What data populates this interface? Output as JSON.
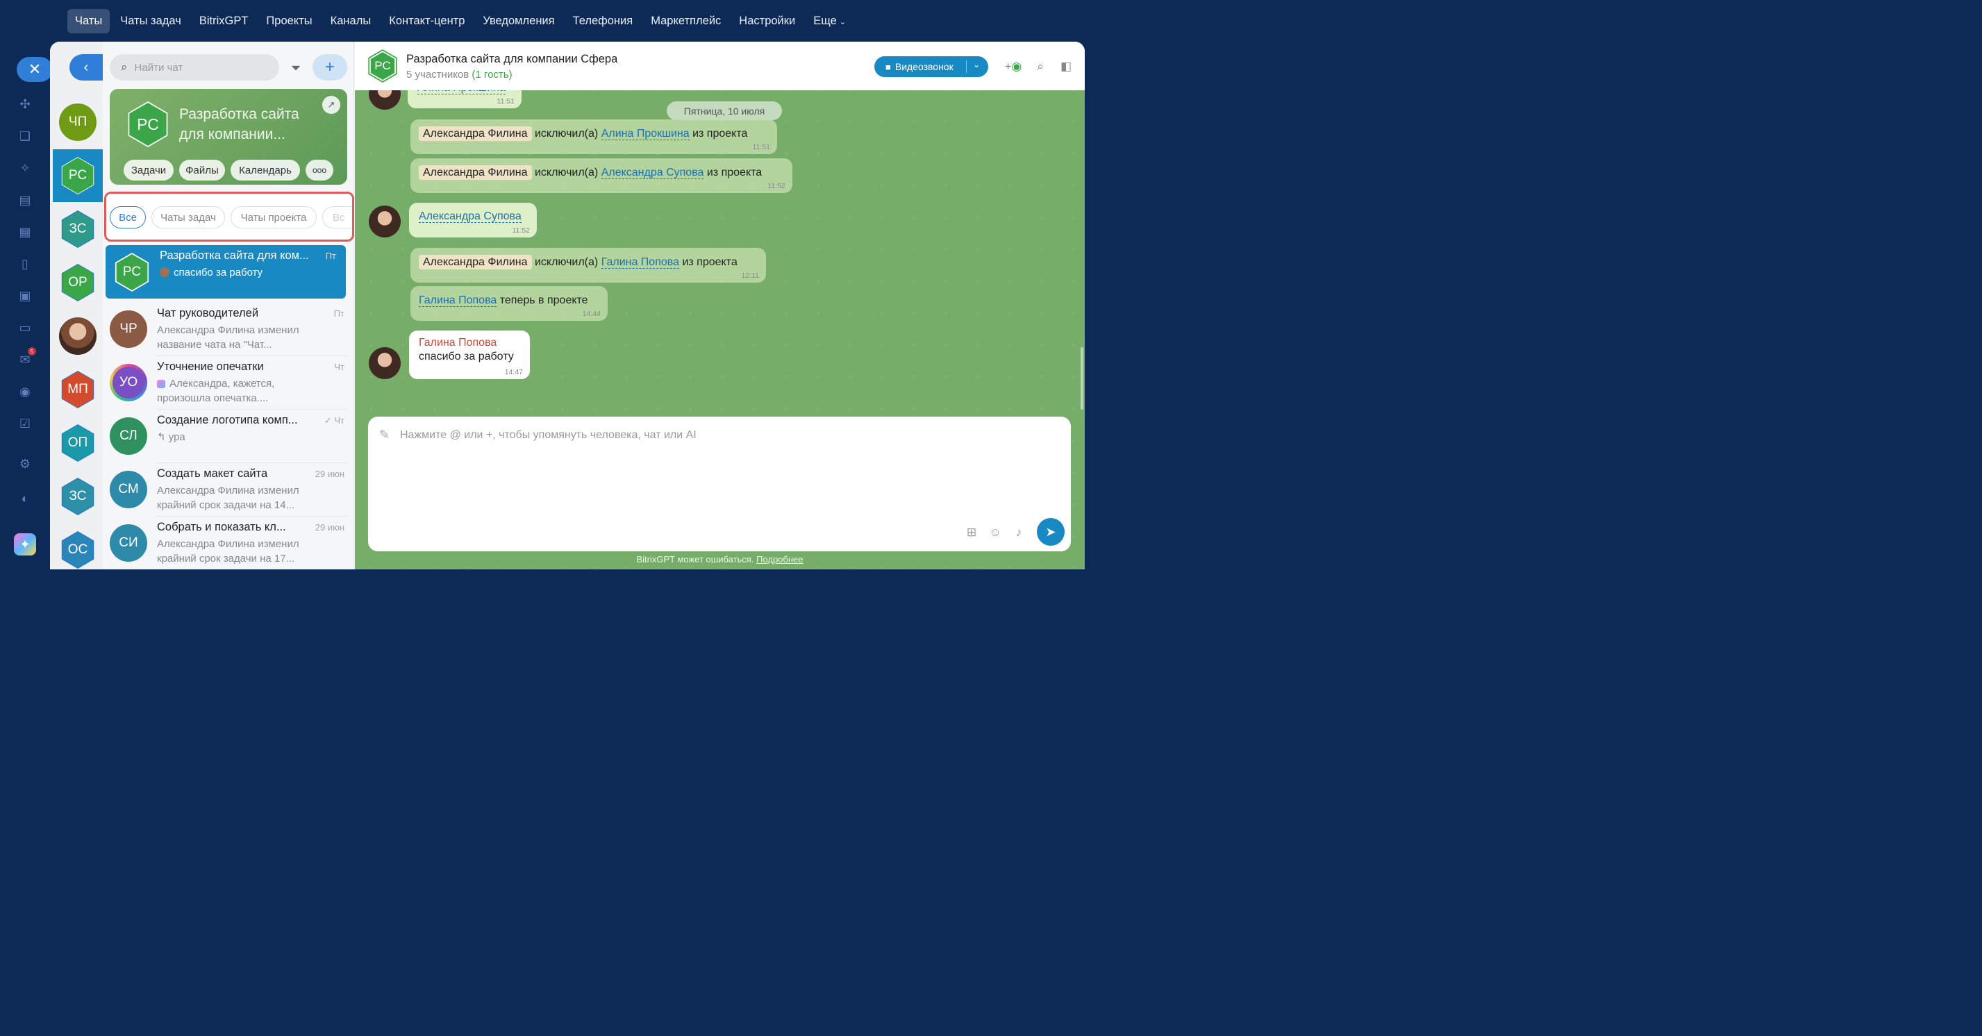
{
  "nav": {
    "items": [
      "Чаты",
      "Чаты задач",
      "BitrixGPT",
      "Проекты",
      "Каналы",
      "Контакт-центр",
      "Уведомления",
      "Телефония",
      "Маркетплейс",
      "Настройки",
      "Еще"
    ],
    "active": "Чаты"
  },
  "strip": {
    "badge": "5"
  },
  "avatars": [
    {
      "initials": "ЧП",
      "shape": "circle",
      "color": "#6e9a14"
    },
    {
      "initials": "РС",
      "shape": "hex",
      "color": "#3aa647"
    },
    {
      "initials": "ЗС",
      "shape": "hex",
      "color": "#2e9a8a"
    },
    {
      "initials": "ОР",
      "shape": "hex",
      "color": "#3aa647"
    },
    {
      "initials": "",
      "shape": "photo",
      "color": "#7b4c33"
    },
    {
      "initials": "МП",
      "shape": "hex",
      "color": "#d44a2c"
    },
    {
      "initials": "ОП",
      "shape": "hex",
      "color": "#1a9aa8"
    },
    {
      "initials": "ЗС",
      "shape": "hex",
      "color": "#2e8fa8"
    },
    {
      "initials": "ОС",
      "shape": "hex",
      "color": "#2a86b8"
    }
  ],
  "search": {
    "placeholder": "Найти чат"
  },
  "card": {
    "initials": "РС",
    "title": "Разработка сайта для компании...",
    "chips": [
      "Задачи",
      "Файлы",
      "Календарь",
      "ооо"
    ]
  },
  "filters": [
    "Все",
    "Чаты задач",
    "Чаты проекта",
    "Вс"
  ],
  "chats": [
    {
      "initials": "РС",
      "title": "Разработка сайта для ком...",
      "preview": "спасибо за работу",
      "time": "Пт",
      "color": "#3aa647",
      "shape": "hex",
      "active": true
    },
    {
      "initials": "ЧР",
      "title": "Чат руководителей",
      "preview": "Александра Филина изменил название чата на \"Чат...",
      "time": "Пт",
      "color": "#8a5a45",
      "shape": "circle",
      "active": false
    },
    {
      "initials": "УО",
      "title": "Уточнение опечатки",
      "preview": "Александра, кажется, произошла опечатка....",
      "time": "Чт",
      "color": "#7a4fc4",
      "shape": "circle",
      "active": false
    },
    {
      "initials": "СЛ",
      "title": "Создание логотипа комп...",
      "preview": "↰ ура",
      "time": "✓ Чт",
      "color": "#2f9060",
      "shape": "circle",
      "active": false
    },
    {
      "initials": "СМ",
      "title": "Создать макет сайта",
      "preview": "Александра Филина изменил крайний срок задачи на 14...",
      "time": "29 июн",
      "color": "#2d8aa8",
      "shape": "circle",
      "active": false
    },
    {
      "initials": "СИ",
      "title": "Собрать и показать кл...",
      "preview": "Александра Филина изменил крайний срок задачи на 17...",
      "time": "29 июн",
      "color": "#2d8aa8",
      "shape": "circle",
      "active": false
    }
  ],
  "header": {
    "initials": "РС",
    "title": "Разработка сайта для компании Сфера",
    "members": "5 участников",
    "guest": "(1 гость)",
    "video_label": "Видеозвонок"
  },
  "messages": {
    "top_partial": "Алина Прокшина",
    "top_time": "11:51",
    "date": "Пятница, 10 июля",
    "sys1": {
      "actor": "Александра Филина",
      "verb": "исключил(а)",
      "target": "Алина Прокшина",
      "tail": "из проекта",
      "time": "11:51"
    },
    "sys2": {
      "actor": "Александра Филина",
      "verb": "исключил(а)",
      "target": "Александра Супова",
      "tail": "из проекта",
      "time": "11:52"
    },
    "user1": {
      "text": "Александра Супова",
      "time": "11:52"
    },
    "sys3": {
      "actor": "Александра Филина",
      "verb": "исключил(а)",
      "target": "Галина Попова",
      "tail": "из проекта",
      "time": "12:11"
    },
    "sys4": {
      "target": "Галина Попова",
      "tail": "теперь в проекте",
      "time": "14:44"
    },
    "last": {
      "author": "Галина Попова",
      "text": "спасибо за работу",
      "time": "14:47"
    }
  },
  "composer": {
    "placeholder": "Нажмите @ или +, чтобы упомянуть человека, чат или AI"
  },
  "disclaimer": {
    "text": "BitrixGPT может ошибаться.",
    "more": "Подробнее"
  }
}
